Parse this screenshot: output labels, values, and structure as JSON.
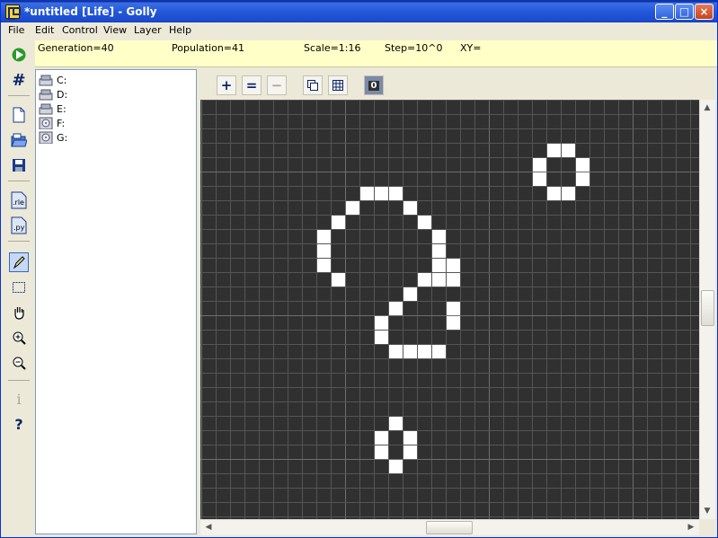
{
  "window": {
    "title": "*untitled [Life] - Golly"
  },
  "menu": [
    "File",
    "Edit",
    "Control",
    "View",
    "Layer",
    "Help"
  ],
  "status": {
    "generation": "Generation=40",
    "population": "Population=41",
    "scale": "Scale=1:16",
    "step": "Step=10^0",
    "xy": "XY="
  },
  "drives": [
    "C:",
    "D:",
    "E:",
    "F:",
    "G:"
  ],
  "editbar": {
    "plus": "+",
    "equals": "=",
    "minus": "−",
    "state": "0"
  },
  "toolbar": {
    "rle": ".rle",
    "py": ".py",
    "info": "i",
    "help": "?"
  },
  "colors": {
    "background": "#303030",
    "live_cell": "#ffffff",
    "grid": "#555555",
    "grid_major": "#6e6e6e"
  },
  "pattern": {
    "scale": 16,
    "live_cells": [
      [
        24,
        3
      ],
      [
        25,
        3
      ],
      [
        23,
        4
      ],
      [
        26,
        4
      ],
      [
        23,
        5
      ],
      [
        26,
        5
      ],
      [
        24,
        6
      ],
      [
        25,
        6
      ],
      [
        11,
        6
      ],
      [
        12,
        6
      ],
      [
        13,
        6
      ],
      [
        10,
        7
      ],
      [
        14,
        7
      ],
      [
        9,
        8
      ],
      [
        15,
        8
      ],
      [
        8,
        9
      ],
      [
        16,
        9
      ],
      [
        8,
        10
      ],
      [
        16,
        10
      ],
      [
        8,
        11
      ],
      [
        16,
        11
      ],
      [
        17,
        11
      ],
      [
        9,
        12
      ],
      [
        15,
        12
      ],
      [
        16,
        12
      ],
      [
        17,
        12
      ],
      [
        14,
        13
      ],
      [
        13,
        14
      ],
      [
        17,
        14
      ],
      [
        12,
        15
      ],
      [
        17,
        15
      ],
      [
        12,
        16
      ],
      [
        13,
        17
      ],
      [
        14,
        17
      ],
      [
        15,
        17
      ],
      [
        16,
        17
      ],
      [
        13,
        22
      ],
      [
        12,
        23
      ],
      [
        14,
        23
      ],
      [
        12,
        24
      ],
      [
        14,
        24
      ],
      [
        13,
        25
      ]
    ]
  }
}
